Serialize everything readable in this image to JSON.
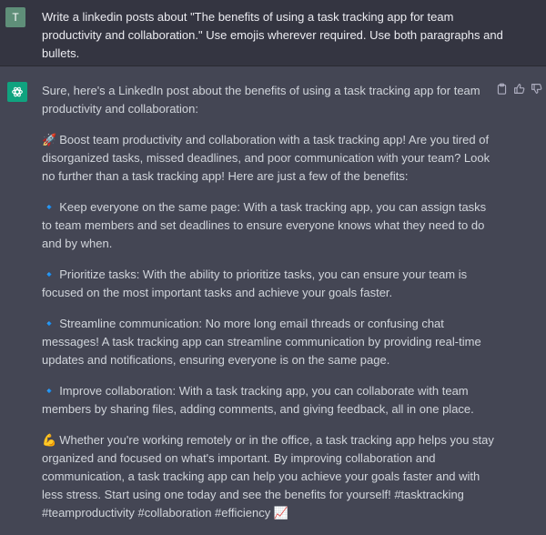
{
  "user": {
    "avatar_letter": "T",
    "message": "Write a linkedin posts about \"The benefits of using a task tracking app for team productivity and collaboration.\" Use emojis wherever required. Use both paragraphs and bullets."
  },
  "assistant": {
    "intro": "Sure, here's a LinkedIn post about the benefits of using a task tracking app for team productivity and collaboration:",
    "paragraphs": [
      {
        "emoji": "🚀",
        "text": "Boost team productivity and collaboration with a task tracking app! Are you tired of disorganized tasks, missed deadlines, and poor communication with your team? Look no further than a task tracking app! Here are just a few of the benefits:"
      },
      {
        "emoji": "🔹",
        "text": "Keep everyone on the same page: With a task tracking app, you can assign tasks to team members and set deadlines to ensure everyone knows what they need to do and by when."
      },
      {
        "emoji": "🔹",
        "text": "Prioritize tasks: With the ability to prioritize tasks, you can ensure your team is focused on the most important tasks and achieve your goals faster."
      },
      {
        "emoji": "🔹",
        "text": "Streamline communication: No more long email threads or confusing chat messages! A task tracking app can streamline communication by providing real-time updates and notifications, ensuring everyone is on the same page."
      },
      {
        "emoji": "🔹",
        "text": "Improve collaboration: With a task tracking app, you can collaborate with team members by sharing files, adding comments, and giving feedback, all in one place."
      },
      {
        "emoji": "💪",
        "text": "Whether you're working remotely or in the office, a task tracking app helps you stay organized and focused on what's important. By improving collaboration and communication, a task tracking app can help you achieve your goals faster and with less stress. Start using one today and see the benefits for yourself! #tasktracking #teamproductivity #collaboration #efficiency 📈"
      }
    ]
  },
  "icons": {
    "copy": "clipboard-icon",
    "like": "thumbs-up-icon",
    "dislike": "thumbs-down-icon",
    "bot": "openai-logo-icon"
  },
  "colors": {
    "user_bg": "#343541",
    "assistant_bg": "#444654",
    "user_avatar": "#5f8f79",
    "bot_avatar": "#10a37f",
    "text": "#d1d5db"
  }
}
